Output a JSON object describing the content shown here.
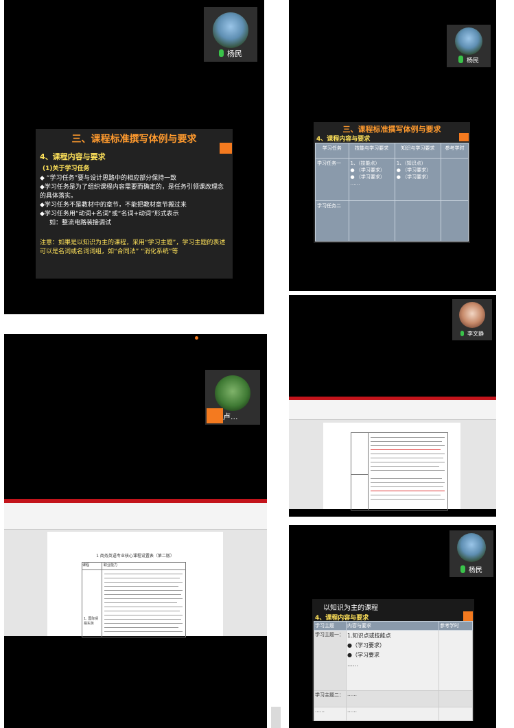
{
  "panel1": {
    "participant": "杨民",
    "slide": {
      "title": "三、课程标准撰写体例与要求",
      "section": "4、课程内容与要求",
      "subsection": "(1)关于学习任务",
      "bullets": [
        "◆ “学习任务”要与设计思路中的相应部分保持一致",
        "◆学习任务是为了组织课程内容需要而确定的，是任务引领课改理念的具体落实。",
        "◆学习任务不是教材中的章节，不能把教材章节搬过来",
        "◆学习任务用“动词+名词”或“名词+动词”形式表示",
        "如：整流电路装接调试"
      ],
      "note": "注意：如果是以知识为主的课程，采用“学习主题”，学习主题的表述可以是名词或名词词组，如“合同法” “消化系统”等"
    }
  },
  "panel2": {
    "participant": "杨民",
    "slide": {
      "title": "三、课程标准撰写体例与要求",
      "section": "4、课程内容与要求",
      "headers": [
        "学习任务",
        "技能与学习要求",
        "知识与学习要求",
        "参考学时"
      ],
      "rows": [
        {
          "task": "学习任务一",
          "skill": [
            "1、（技能点）",
            "● （学习要求）",
            "● （学习要求）",
            "……"
          ],
          "knowledge": [
            "1、（知识点）",
            "● （学习要求）",
            "● （学习要求）"
          ]
        },
        {
          "task": "学习任务二",
          "skill": [],
          "knowledge": []
        }
      ]
    }
  },
  "panel3": {
    "participant": "卢...",
    "doc_title": "1 商务英语专业核心课程设置表（第二版）",
    "table_headers": [
      "课程",
      "职业能力"
    ],
    "row_label": "1. 国际贸易实务"
  },
  "panel4": {
    "participant": "李文静"
  },
  "panel5": {
    "participant": "杨民",
    "slide": {
      "title": "以知识为主的课程",
      "section": "4、课程内容与要求",
      "headers": [
        "学习主题",
        "内容与要求",
        "参考学时"
      ],
      "rows": [
        {
          "topic": "学习主题一：",
          "content": [
            "1.知识点或技能点",
            "●（学习要求）",
            "●（学习要求",
            "……"
          ]
        },
        {
          "topic": "学习主题二：",
          "content": [
            "……"
          ]
        },
        {
          "topic": "……",
          "content": [
            "……"
          ]
        }
      ]
    }
  }
}
